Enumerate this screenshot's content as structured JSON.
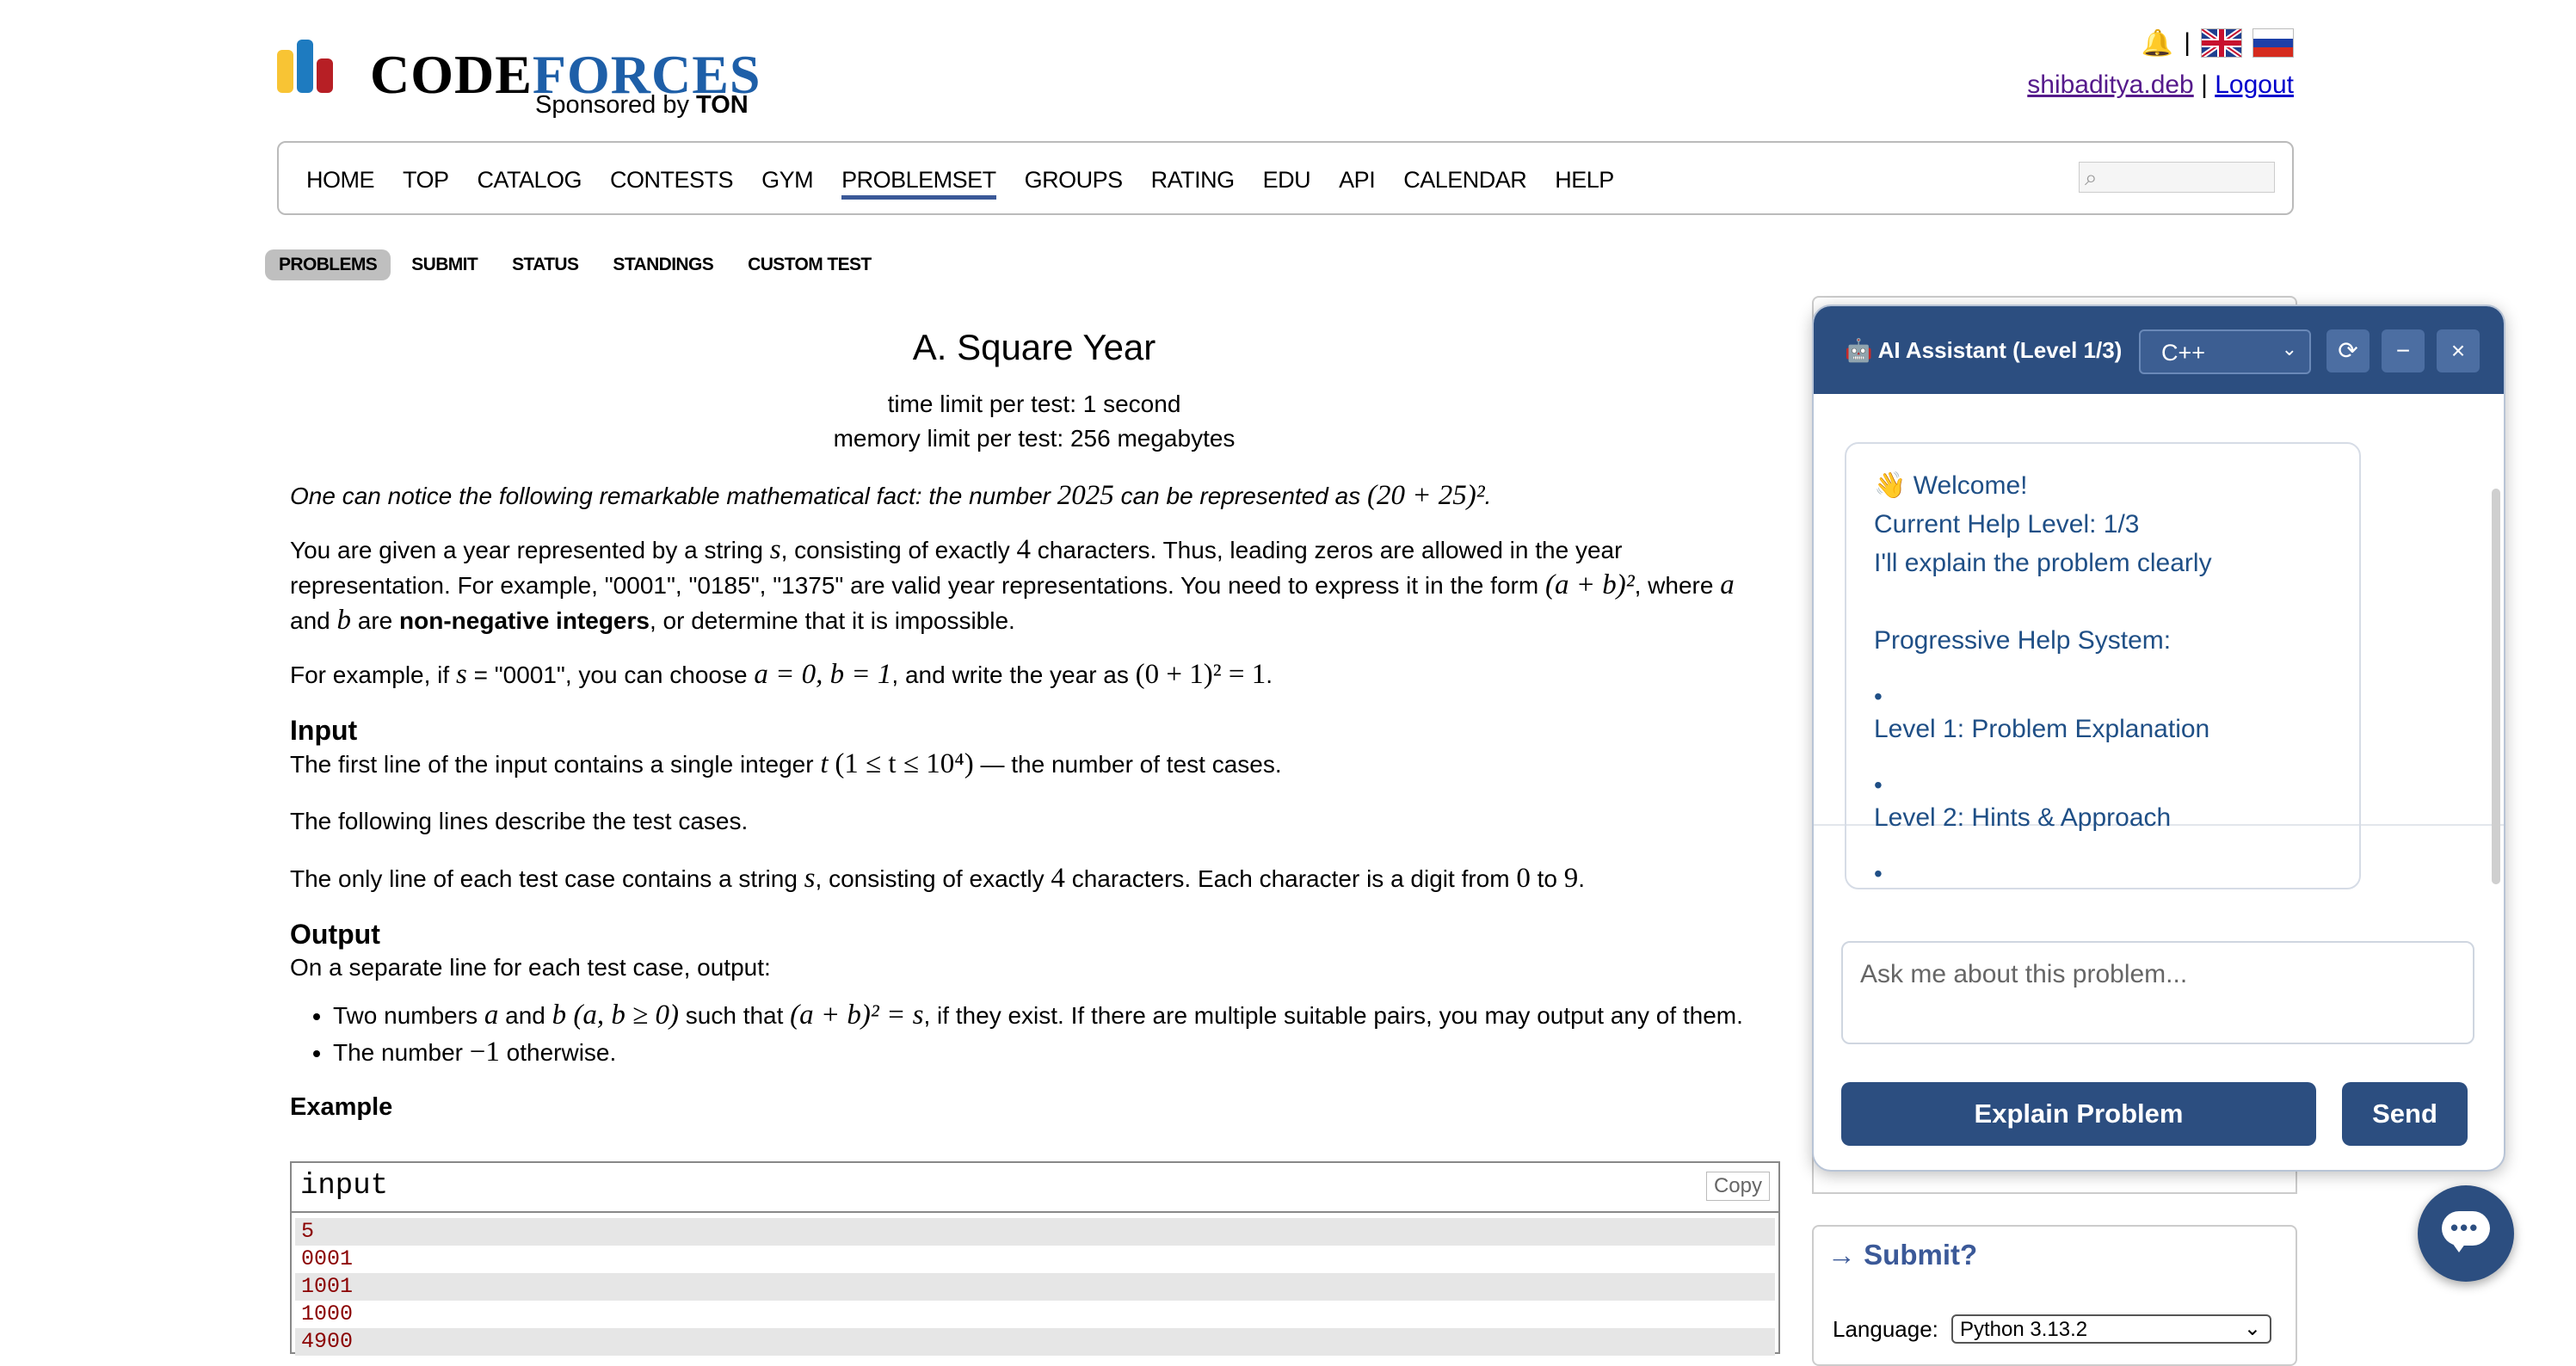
{
  "brand": {
    "name_code": "CODE",
    "name_forces": "FORCES",
    "sponsored_by": "Sponsored by",
    "sponsor": "TON",
    "colors": {
      "yellow": "#f8c434",
      "blue": "#1e7bc0",
      "red": "#b71f25",
      "forces": "#1e5fa8"
    }
  },
  "user": {
    "handle": "shibaditya.deb",
    "separator": "|",
    "logout": "Logout"
  },
  "main_nav": [
    "HOME",
    "TOP",
    "CATALOG",
    "CONTESTS",
    "GYM",
    "PROBLEMSET",
    "GROUPS",
    "RATING",
    "EDU",
    "API",
    "CALENDAR",
    "HELP"
  ],
  "main_nav_active": "PROBLEMSET",
  "second_nav": [
    "PROBLEMS",
    "SUBMIT",
    "STATUS",
    "STANDINGS",
    "CUSTOM TEST"
  ],
  "problem": {
    "title": "A. Square Year",
    "time_limit": "time limit per test: 1 second",
    "memory_limit": "memory limit per test: 256 megabytes",
    "intro_pre": "One can notice the following remarkable mathematical fact: the number ",
    "intro_num": "2025",
    "intro_mid": " can be represented as ",
    "intro_expr": "(20 + 25)²",
    "intro_end": ".",
    "p1_a": "You are given a year represented by a string ",
    "p1_s": "s",
    "p1_b": ", consisting of exactly ",
    "p1_4": "4",
    "p1_c": " characters. Thus, leading zeros are allowed in the year representation. For example, \"0001\", \"0185\", \"1375\" are valid year representations. You need to express it in the form ",
    "p1_expr": "(a + b)²",
    "p1_d": ", where ",
    "p1_a_var": "a",
    "p1_e": " and ",
    "p1_b_var": "b",
    "p1_f": " are ",
    "p1_bold": "non-negative integers",
    "p1_g": ", or determine that it is impossible.",
    "p2_a": "For example, if ",
    "p2_s": "s",
    "p2_b": " = \"0001\", you can choose ",
    "p2_expr1": "a = 0, b = 1",
    "p2_c": ", and write the year as ",
    "p2_expr2": "(0 + 1)² = 1",
    "p2_d": ".",
    "input_title": "Input",
    "input_p1_a": "The first line of the input contains a single integer ",
    "input_p1_t": "t",
    "input_p1_expr": "(1 ≤ t ≤ 10⁴)",
    "input_p1_b": " — the number of test cases.",
    "input_p2": "The following lines describe the test cases.",
    "input_p3_a": "The only line of each test case contains a string ",
    "input_p3_s": "s",
    "input_p3_b": ", consisting of exactly ",
    "input_p3_4": "4",
    "input_p3_c": " characters. Each character is a digit from ",
    "input_p3_0": "0",
    "input_p3_d": " to ",
    "input_p3_9": "9",
    "input_p3_e": ".",
    "output_title": "Output",
    "output_p1": "On a separate line for each test case, output:",
    "out_li1_a": "Two numbers ",
    "out_li1_a_var": "a",
    "out_li1_b": " and ",
    "out_li1_b_var": "b",
    "out_li1_cond": " (a, b ≥ 0)",
    "out_li1_c": " such that ",
    "out_li1_expr": "(a + b)² = s",
    "out_li1_d": ", if they exist. If there are multiple suitable pairs, you may output any of them.",
    "out_li2_a": "The number ",
    "out_li2_num": "−1",
    "out_li2_b": " otherwise.",
    "example_title": "Example",
    "example_input_label": "input",
    "copy_label": "Copy",
    "example_lines": [
      "5",
      "0001",
      "1001",
      "1000",
      "4900"
    ]
  },
  "submit_box": {
    "title": "→ Submit?",
    "language_label": "Language:",
    "language_value": "Python 3.13.2"
  },
  "ai": {
    "title": "🤖 AI Assistant (Level 1/3)",
    "language": "C++",
    "welcome": "👋 Welcome!",
    "level_line": "Current Help Level: 1/3",
    "explain_line": "I'll explain the problem clearly",
    "system_title": "Progressive Help System:",
    "bullet": "•",
    "level1": "Level 1: Problem Explanation",
    "level2": "Level 2: Hints & Approach",
    "input_placeholder": "Ask me about this problem...",
    "explain_button": "Explain Problem",
    "send_button": "Send",
    "refresh_icon": "⟳",
    "minimize_icon": "−",
    "close_icon": "×"
  },
  "chat_fab": {
    "dots": "•••"
  }
}
